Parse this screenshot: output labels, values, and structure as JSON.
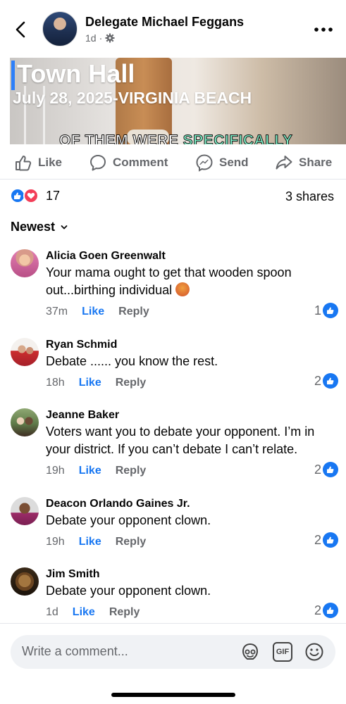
{
  "header": {
    "name": "Delegate Michael Feggans",
    "time": "1d",
    "separator": "·",
    "privacy_icon": "gear-icon",
    "back_icon": "chevron-left-icon",
    "more_icon": "more-dots-icon"
  },
  "media": {
    "title": "Town Hall",
    "subtitle": "July 28, 2025-VIRGINIA BEACH",
    "caption_start": "OF THEM WERE ",
    "caption_highlight": "SPECIFICALLY"
  },
  "actions": [
    {
      "label": "Like",
      "icon": "thumbs-up-icon"
    },
    {
      "label": "Comment",
      "icon": "comment-bubble-icon"
    },
    {
      "label": "Send",
      "icon": "messenger-icon"
    },
    {
      "label": "Share",
      "icon": "share-arrow-icon"
    }
  ],
  "reactions": {
    "count": "17",
    "types": [
      "like",
      "love"
    ]
  },
  "shares": "3 shares",
  "sort": {
    "label": "Newest"
  },
  "comments": [
    {
      "name": "Alicia Goen Greenwalt",
      "text": "Your mama ought to get that wooden spoon out...birthing individual",
      "emoji": "angry-face-emoji",
      "time": "37m",
      "like": "Like",
      "reply": "Reply",
      "reactions": "1"
    },
    {
      "name": "Ryan Schmid",
      "text": "Debate ...... you know the rest.",
      "time": "18h",
      "like": "Like",
      "reply": "Reply",
      "reactions": "2"
    },
    {
      "name": "Jeanne Baker",
      "text": "Voters want you to debate your opponent. I’m in your district. If you can’t debate I can’t relate.",
      "time": "19h",
      "like": "Like",
      "reply": "Reply",
      "reactions": "2"
    },
    {
      "name": "Deacon Orlando Gaines Jr.",
      "text": "Debate your opponent clown.",
      "time": "19h",
      "like": "Like",
      "reply": "Reply",
      "reactions": "2"
    },
    {
      "name": "Jim Smith",
      "text": "Debate your opponent clown.",
      "time": "1d",
      "like": "Like",
      "reply": "Reply",
      "reactions": "2"
    }
  ],
  "composer": {
    "placeholder": "Write a comment...",
    "icons": [
      "avatar-sticker-icon",
      "gif-icon",
      "emoji-icon"
    ],
    "gif_label": "GIF"
  },
  "colors": {
    "accent": "#1877f2",
    "love": "#f33e58",
    "muted": "#65676b"
  }
}
